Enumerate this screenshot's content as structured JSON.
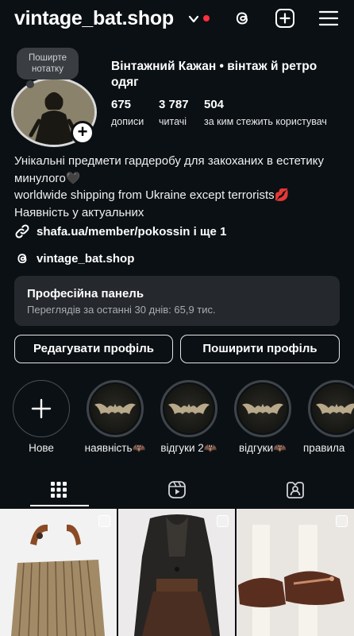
{
  "header": {
    "username": "vintage_bat.shop",
    "icons": [
      "chevron-down-icon",
      "notification-dot",
      "threads-icon",
      "create-post-icon",
      "menu-icon"
    ]
  },
  "profile": {
    "note_text": "Поширте нотатку",
    "full_name": "Вінтажний Кажан • вінтаж й ретро одяг",
    "stats": [
      {
        "value": "675",
        "label": "дописи"
      },
      {
        "value": "3 787",
        "label": "читачі"
      },
      {
        "value": "504",
        "label": "за ким стежить користувач"
      }
    ],
    "bio_lines": [
      "Унікальні предмети гардеробу для закоханих в естетику минулого🖤",
      "worldwide shipping from Ukraine except terrorists💋",
      "Наявність у актуальних"
    ],
    "link": "shafa.ua/member/pokossin і ще 1",
    "threads_handle": "vintage_bat.shop"
  },
  "pro_panel": {
    "title": "Професійна панель",
    "subtitle": "Переглядів за останні 30 днів: 65,9 тис."
  },
  "buttons": {
    "edit_profile": "Редагувати профіль",
    "share_profile": "Поширити профіль"
  },
  "highlights": [
    {
      "label": "Нове",
      "type": "new"
    },
    {
      "label": "наявність🦇",
      "type": "bat"
    },
    {
      "label": "відгуки 2🦇",
      "type": "bat"
    },
    {
      "label": "відгуки🦇",
      "type": "bat"
    },
    {
      "label": "правила",
      "type": "bat"
    }
  ],
  "tabs": [
    {
      "name": "posts-grid",
      "icon": "grid-icon",
      "active": true
    },
    {
      "name": "reels",
      "icon": "reels-icon",
      "active": false
    },
    {
      "name": "tagged",
      "icon": "tagged-icon",
      "active": false
    }
  ],
  "colors": {
    "background": "#0b1014",
    "panel": "#25292e",
    "notification": "#ff3040",
    "muted_text": "#a8adb3"
  }
}
